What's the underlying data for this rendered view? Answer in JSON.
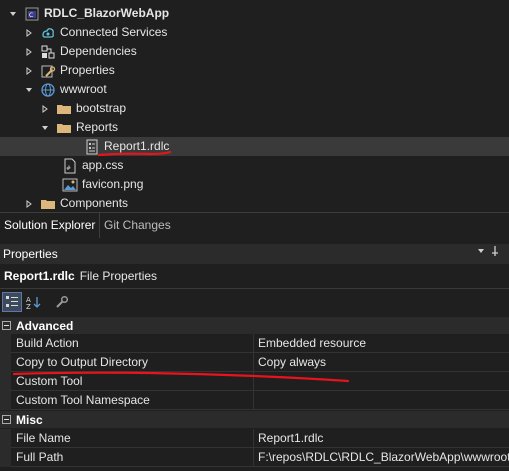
{
  "tree": {
    "project": "RDLC_BlazorWebApp",
    "items": [
      {
        "label": "Connected Services",
        "icon": "connected-services-icon"
      },
      {
        "label": "Dependencies",
        "icon": "dependencies-icon"
      },
      {
        "label": "Properties",
        "icon": "properties-wrench-icon"
      },
      {
        "label": "wwwroot",
        "icon": "globe-icon"
      },
      {
        "label": "bootstrap",
        "icon": "folder-icon"
      },
      {
        "label": "Reports",
        "icon": "folder-icon"
      },
      {
        "label": "Report1.rdlc",
        "icon": "report-file-icon"
      },
      {
        "label": "app.css",
        "icon": "css-file-icon"
      },
      {
        "label": "favicon.png",
        "icon": "image-file-icon"
      },
      {
        "label": "Components",
        "icon": "folder-icon"
      }
    ]
  },
  "tabs": {
    "solution_explorer": "Solution Explorer",
    "git_changes": "Git Changes"
  },
  "properties": {
    "title": "Properties",
    "object_name": "Report1.rdlc",
    "object_kind": "File Properties",
    "categories": [
      {
        "label": "Advanced",
        "rows": [
          {
            "name": "Build Action",
            "value": "Embedded resource"
          },
          {
            "name": "Copy to Output Directory",
            "value": "Copy always"
          },
          {
            "name": "Custom Tool",
            "value": ""
          },
          {
            "name": "Custom Tool Namespace",
            "value": ""
          }
        ]
      },
      {
        "label": "Misc",
        "rows": [
          {
            "name": "File Name",
            "value": "Report1.rdlc"
          },
          {
            "name": "Full Path",
            "value": "F:\\repos\\RDLC\\RDLC_BlazorWebApp\\wwwroot\\Rep"
          }
        ]
      }
    ]
  },
  "colors": {
    "background": "#1f1f1f",
    "selection": "#3a3a3a",
    "annotation_red": "#e8141c",
    "folder": "#dcb67a",
    "accent_blue": "#5b9bd5"
  }
}
